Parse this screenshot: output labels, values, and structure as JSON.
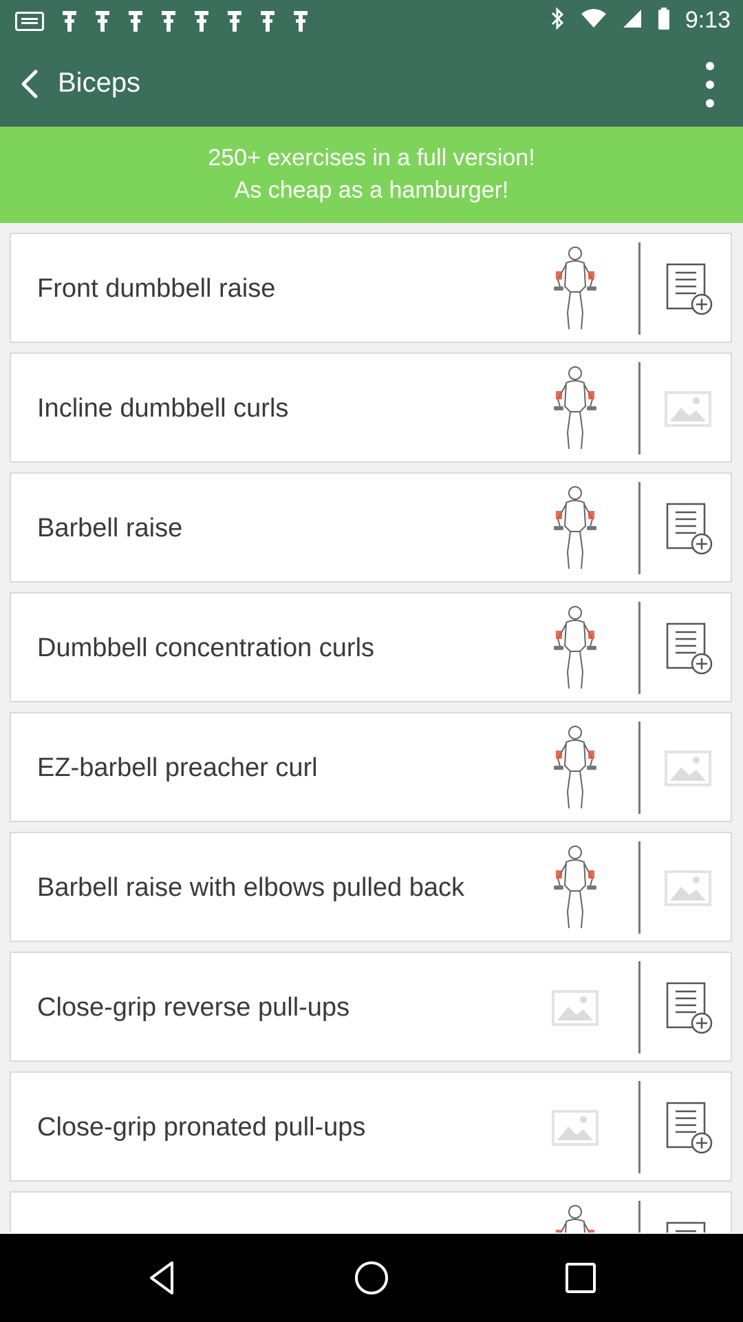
{
  "status_bar": {
    "time": "9:13",
    "left_icons": [
      "message-icon",
      "fitness-icon",
      "fitness-icon",
      "fitness-icon",
      "fitness-icon",
      "fitness-icon",
      "fitness-icon",
      "fitness-icon",
      "fitness-icon"
    ],
    "right_icons": [
      "bluetooth-icon",
      "wifi-icon",
      "signal-icon",
      "battery-icon"
    ]
  },
  "app_bar": {
    "title": "Biceps",
    "back_icon": "arrow-left-icon",
    "menu_icon": "more-vertical-icon"
  },
  "promo": {
    "line1": "250+ exercises in a full version!",
    "line2": "As cheap as a hamburger!",
    "color": "#7ed45a"
  },
  "exercises": [
    {
      "name": "Front dumbbell raise",
      "thumbnail": "figure",
      "action": "add-to-list-icon"
    },
    {
      "name": "Incline dumbbell curls",
      "thumbnail": "figure",
      "action": "image-icon"
    },
    {
      "name": "Barbell raise",
      "thumbnail": "figure",
      "action": "add-to-list-icon"
    },
    {
      "name": "Dumbbell concentration curls",
      "thumbnail": "figure",
      "action": "add-to-list-icon"
    },
    {
      "name": "EZ-barbell preacher curl",
      "thumbnail": "figure",
      "action": "image-icon"
    },
    {
      "name": "Barbell raise with elbows pulled back",
      "thumbnail": "figure",
      "action": "image-icon"
    },
    {
      "name": "Close-grip reverse pull-ups",
      "thumbnail": "image-placeholder",
      "action": "add-to-list-icon"
    },
    {
      "name": "Close-grip pronated pull-ups",
      "thumbnail": "image-placeholder",
      "action": "add-to-list-icon"
    },
    {
      "name": "",
      "thumbnail": "figure",
      "action": "add-to-list-icon"
    }
  ],
  "nav_bar": {
    "buttons": [
      "back-triangle-icon",
      "home-circle-icon",
      "recents-square-icon"
    ]
  },
  "colors": {
    "header": "#3b6e5b",
    "promo": "#7ed45a",
    "row_bg": "#ffffff",
    "text": "#3a3a3a",
    "muscle_highlight": "#e0533a"
  }
}
